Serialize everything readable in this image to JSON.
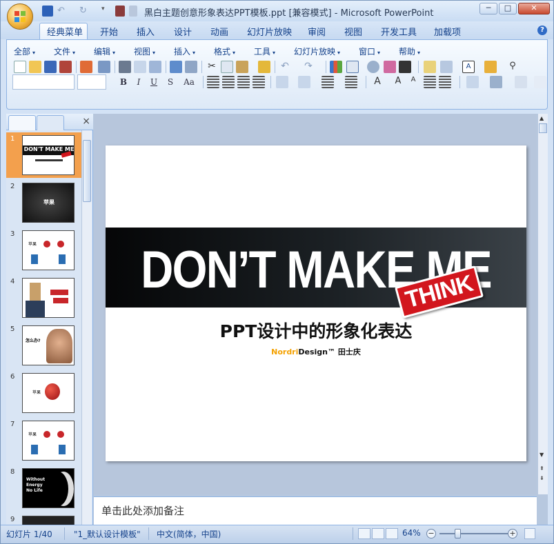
{
  "window": {
    "title": "黑白主题创意形象表达PPT模板.ppt [兼容模式] - Microsoft PowerPoint",
    "minimize": "─",
    "maximize": "□",
    "close": "✕"
  },
  "ribbon_tabs": [
    "经典菜单",
    "开始",
    "插入",
    "设计",
    "动画",
    "幻灯片放映",
    "审阅",
    "视图",
    "开发工具",
    "加载项"
  ],
  "help": "?",
  "menubar": [
    "全部",
    "文件",
    "编辑",
    "视图",
    "插入",
    "格式",
    "工具",
    "幻灯片放映",
    "窗口",
    "帮助"
  ],
  "format_buttons": {
    "bold": "B",
    "italic": "I",
    "underline": "U",
    "shadow": "S",
    "case": "Aa"
  },
  "slides_panel": {
    "close": "×",
    "thumbs": [
      {
        "num": "1",
        "text": "DON'T MAKE ME"
      },
      {
        "num": "2",
        "text": "苹果"
      },
      {
        "num": "3",
        "text": "苹果"
      },
      {
        "num": "4",
        "text": ""
      },
      {
        "num": "5",
        "text": "怎么办?"
      },
      {
        "num": "6",
        "text": "苹果"
      },
      {
        "num": "7",
        "text": "苹果"
      },
      {
        "num": "8",
        "text": "Without Energy No Life"
      },
      {
        "num": "9",
        "text": ""
      }
    ]
  },
  "slide": {
    "headline": "DON’T MAKE ME",
    "stamp": "THINK",
    "title": "PPT设计中的形象化表达",
    "byline_brand_a": "Nordri",
    "byline_brand_b": "Design™",
    "byline_author": "田士庆"
  },
  "notes": {
    "placeholder": "单击此处添加备注"
  },
  "statusbar": {
    "slide_position": "幻灯片 1/40",
    "theme": "\"1_默认设计模板\"",
    "language": "中文(简体，中国)",
    "zoom": "64%",
    "zoom_level_percent": 64
  },
  "colors": {
    "accent_orange": "#f3a04d",
    "ribbon_blue": "#15428b",
    "stamp_red": "#d2161d",
    "brand_orange": "#f4a100"
  }
}
